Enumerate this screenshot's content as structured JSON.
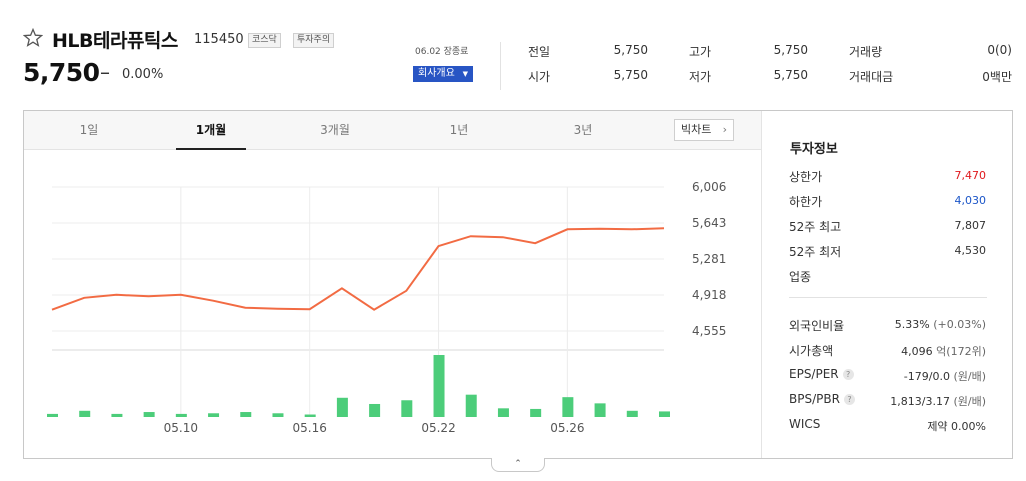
{
  "stock": {
    "name": "HLB테라퓨틱스",
    "code": "115450",
    "market_tag": "코스닥",
    "warning_tag": "투자주의",
    "price": "5,750",
    "change_symbol": "–",
    "change_rate": "0.00%"
  },
  "header": {
    "close_date": "06.02 장종료",
    "company_button": "회사개요",
    "quote": {
      "prev_label": "전일",
      "prev_value": "5,750",
      "open_label": "시가",
      "open_value": "5,750",
      "high_label": "고가",
      "high_value": "5,750",
      "low_label": "저가",
      "low_value": "5,750",
      "volume_label": "거래량",
      "volume_value": "0(0)",
      "amount_label": "거래대금",
      "amount_value": "0백만"
    }
  },
  "tabs": [
    "1일",
    "1개월",
    "3개월",
    "1년",
    "3년"
  ],
  "active_tab": "1개월",
  "bigchart_label": "빅차트",
  "bigchart_arrow": "›",
  "fold_button": "⌃",
  "colors": {
    "price_line": "#f26b43",
    "volume_bar": "#4ccd7a",
    "up": "#e0191d",
    "down": "#1c56c8",
    "company_button": "#2855c4"
  },
  "chart_data": {
    "type": "line",
    "title": "",
    "y_ticks": [
      "6,006",
      "5,643",
      "5,281",
      "4,918",
      "4,555"
    ],
    "ylim": [
      4555,
      6006
    ],
    "x_ticks": [
      "05.10",
      "05.16",
      "05.22",
      "05.26"
    ],
    "x_tick_index": [
      4,
      8,
      12,
      16
    ],
    "series": [
      {
        "values": [
          4770,
          4890,
          4920,
          4905,
          4920,
          4860,
          4790,
          4780,
          4775,
          4985,
          4770,
          4960,
          5410,
          5510,
          5500,
          5440,
          5580,
          5585,
          5580,
          5590
        ]
      }
    ],
    "volume_relative": [
      0.05,
      0.1,
      0.05,
      0.08,
      0.05,
      0.06,
      0.08,
      0.06,
      0.04,
      0.31,
      0.21,
      0.27,
      1.0,
      0.36,
      0.14,
      0.13,
      0.32,
      0.22,
      0.1,
      0.09
    ]
  },
  "info": {
    "title": "투자정보",
    "upper_label": "상한가",
    "upper_value": "7,470",
    "lower_label": "하한가",
    "lower_value": "4,030",
    "high52_label": "52주 최고",
    "high52_value": "7,807",
    "low52_label": "52주 최저",
    "low52_value": "4,530",
    "industry_label": "업종",
    "foreign_label": "외국인비율",
    "foreign_value": "5.33%",
    "foreign_change": "(+0.03%)",
    "cap_label": "시가총액",
    "cap_value": "4,096",
    "cap_unit": "억(172위)",
    "eps_label": "EPS/PER",
    "eps_value": "-179/0.0",
    "eps_unit": "(원/배)",
    "bps_label": "BPS/PBR",
    "bps_value": "1,813/3.17",
    "bps_unit": "(원/배)",
    "wics_label": "WICS",
    "wics_value": "제약 0.00%",
    "help_glyph": "?"
  }
}
